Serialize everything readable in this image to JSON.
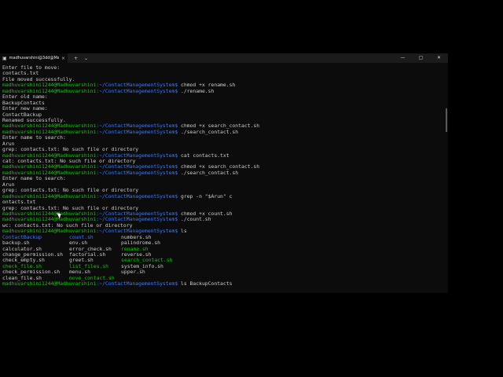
{
  "window": {
    "tab_title": "madhuvarshini@3dd@Madhuv",
    "new_tab": "+",
    "dropdown": "⌄",
    "minimize": "—",
    "maximize": "▢",
    "close": "✕"
  },
  "prompt": {
    "user": "madhuvarshini1244@Madhuvarshini",
    "path": ":~/ContactManagementSystem$"
  },
  "lines": [
    {
      "t": "out",
      "text": "Enter file to move:"
    },
    {
      "t": "out",
      "text": "contacts.txt"
    },
    {
      "t": "out",
      "text": "File moved successfully."
    },
    {
      "t": "cmd",
      "text": " chmod +x rename.sh"
    },
    {
      "t": "cmd",
      "text": " ./rename.sh"
    },
    {
      "t": "out",
      "text": "Enter old name:"
    },
    {
      "t": "out",
      "text": "BackupContacts"
    },
    {
      "t": "out",
      "text": "Enter new name:"
    },
    {
      "t": "out",
      "text": "ContactBackup"
    },
    {
      "t": "out",
      "text": "Renamed successfully."
    },
    {
      "t": "cmd",
      "text": " chmod +x search_contact.sh"
    },
    {
      "t": "cmd",
      "text": " ./search_contact.sh"
    },
    {
      "t": "out",
      "text": "Enter name to search:"
    },
    {
      "t": "out",
      "text": "Arun"
    },
    {
      "t": "out",
      "text": "grep: contacts.txt: No such file or directory"
    },
    {
      "t": "cmd",
      "text": " cat contacts.txt"
    },
    {
      "t": "out",
      "text": "cat: contacts.txt: No such file or directory"
    },
    {
      "t": "cmd",
      "text": " chmod +x search_contact.sh"
    },
    {
      "t": "cmd",
      "text": " ./search_contact.sh"
    },
    {
      "t": "out",
      "text": "Enter name to search:"
    },
    {
      "t": "out",
      "text": "Arun"
    },
    {
      "t": "out",
      "text": "grep: contacts.txt: No such file or directory"
    },
    {
      "t": "cmd",
      "text": " grep -n \"$Arun\" c"
    },
    {
      "t": "out",
      "text": "ontacts.txt"
    },
    {
      "t": "out",
      "text": "grep: contacts.txt: No such file or directory"
    },
    {
      "t": "cmd",
      "text": " chmod +x count.sh"
    },
    {
      "t": "cmd",
      "text": " ./count.sh"
    },
    {
      "t": "out",
      "text": "wc: contacts.txt: No such file or directory"
    },
    {
      "t": "cmd",
      "text": " ls"
    }
  ],
  "ls_output": [
    [
      {
        "n": "ContactBackup",
        "c": "b"
      },
      {
        "n": "count.sh",
        "c": "b"
      },
      {
        "n": "numbers.sh",
        "c": ""
      }
    ],
    [
      {
        "n": "backup.sh",
        "c": ""
      },
      {
        "n": "env.sh",
        "c": ""
      },
      {
        "n": "palindrome.sh",
        "c": ""
      }
    ],
    [
      {
        "n": "calculator.sh",
        "c": ""
      },
      {
        "n": "error_check.sh",
        "c": ""
      },
      {
        "n": "rename.sh",
        "c": "g"
      }
    ],
    [
      {
        "n": "change_permission.sh",
        "c": ""
      },
      {
        "n": "factorial.sh",
        "c": ""
      },
      {
        "n": "reverse.sh",
        "c": ""
      }
    ],
    [
      {
        "n": "check_empty.sh",
        "c": ""
      },
      {
        "n": "greet.sh",
        "c": ""
      },
      {
        "n": "search_contact.sh",
        "c": "g"
      }
    ],
    [
      {
        "n": "check_file.sh",
        "c": "g"
      },
      {
        "n": "list_files.sh",
        "c": "g"
      },
      {
        "n": "system_info.sh",
        "c": ""
      }
    ],
    [
      {
        "n": "check_permission.sh",
        "c": ""
      },
      {
        "n": "menu.sh",
        "c": ""
      },
      {
        "n": "upper.sh",
        "c": ""
      }
    ],
    [
      {
        "n": "clean_file.sh",
        "c": ""
      },
      {
        "n": "move_contact.sh",
        "c": "g"
      },
      {
        "n": "",
        "c": ""
      }
    ]
  ],
  "last_command": " ls BackupContacts"
}
